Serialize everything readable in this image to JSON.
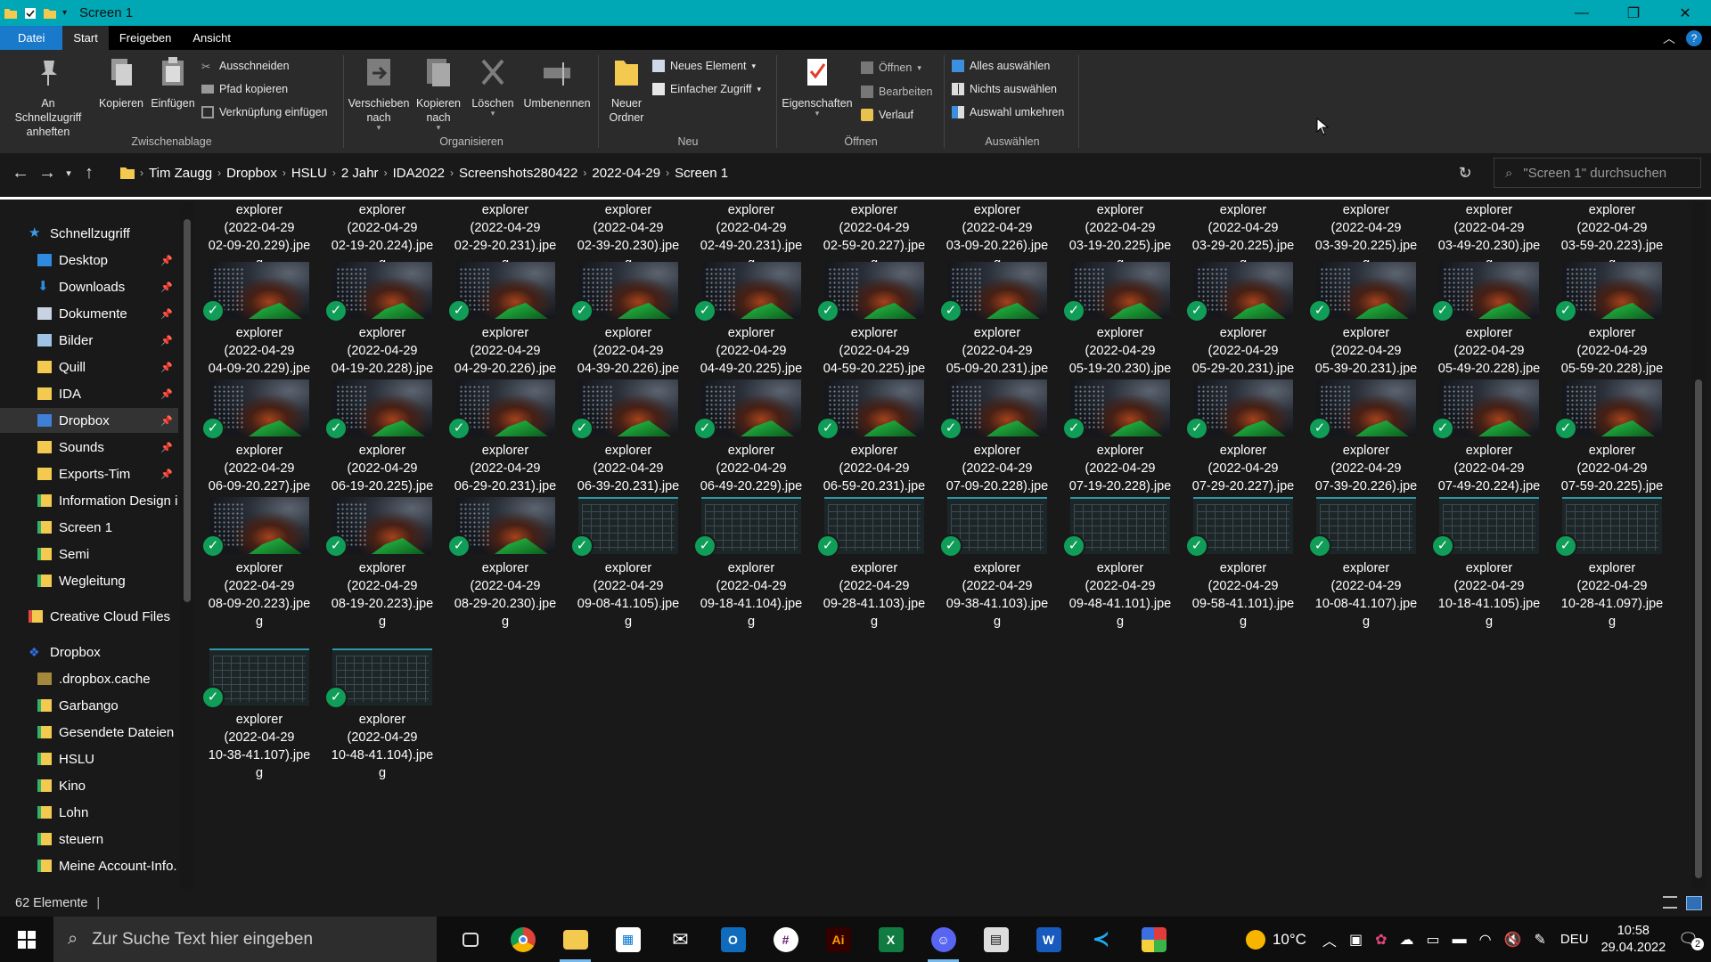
{
  "window": {
    "title": "Screen 1"
  },
  "ribbon_tabs": [
    "Datei",
    "Start",
    "Freigeben",
    "Ansicht"
  ],
  "ribbon": {
    "clipboard": {
      "pin": "An Schnellzugriff anheften",
      "copy": "Kopieren",
      "paste": "Einfügen",
      "cut": "Ausschneiden",
      "copy_path": "Pfad kopieren",
      "paste_link": "Verknüpfung einfügen",
      "label": "Zwischenablage"
    },
    "organize": {
      "move": "Verschieben nach",
      "copyto": "Kopieren nach",
      "delete": "Löschen",
      "rename": "Umbenennen",
      "label": "Organisieren"
    },
    "new": {
      "new_folder": "Neuer Ordner",
      "new_item": "Neues Element",
      "easy_access": "Einfacher Zugriff",
      "label": "Neu"
    },
    "open": {
      "properties": "Eigenschaften",
      "open": "Öffnen",
      "edit": "Bearbeiten",
      "history": "Verlauf",
      "label": "Öffnen"
    },
    "select": {
      "all": "Alles auswählen",
      "none": "Nichts auswählen",
      "invert": "Auswahl umkehren",
      "label": "Auswählen"
    }
  },
  "breadcrumb": [
    "Tim Zaugg",
    "Dropbox",
    "HSLU",
    "2 Jahr",
    "IDA2022",
    "Screenshots280422",
    "2022-04-29",
    "Screen 1"
  ],
  "search": {
    "placeholder": "\"Screen 1\" durchsuchen"
  },
  "nav": {
    "quick_access": "Schnellzugriff",
    "items": [
      {
        "label": "Desktop",
        "pinned": true
      },
      {
        "label": "Downloads",
        "pinned": true
      },
      {
        "label": "Dokumente",
        "pinned": true
      },
      {
        "label": "Bilder",
        "pinned": true
      },
      {
        "label": "Quill",
        "pinned": true
      },
      {
        "label": "IDA",
        "pinned": true
      },
      {
        "label": "Dropbox",
        "pinned": true
      },
      {
        "label": "Sounds",
        "pinned": true
      },
      {
        "label": "Exports-Tim",
        "pinned": true
      },
      {
        "label": "Information Design i",
        "pinned": false
      },
      {
        "label": "Screen 1",
        "pinned": false
      },
      {
        "label": "Semi",
        "pinned": false
      },
      {
        "label": "Wegleitung",
        "pinned": false
      }
    ],
    "creative_cloud": "Creative Cloud Files",
    "dropbox": "Dropbox",
    "dropbox_items": [
      ".dropbox.cache",
      "Garbango",
      "Gesendete Dateien",
      "HSLU",
      "Kino",
      "Lohn",
      "steuern",
      "Meine Account-Info."
    ]
  },
  "files": {
    "top_partial": [
      [
        "explorer",
        "(2022-04-29",
        "02-09-20.229).jpe",
        "g"
      ],
      [
        "explorer",
        "(2022-04-29",
        "02-19-20.224).jpe",
        "g"
      ],
      [
        "explorer",
        "(2022-04-29",
        "02-29-20.231).jpe",
        "g"
      ],
      [
        "explorer",
        "(2022-04-29",
        "02-39-20.230).jpe",
        "g"
      ],
      [
        "explorer",
        "(2022-04-29",
        "02-49-20.231).jpe",
        "g"
      ],
      [
        "explorer",
        "(2022-04-29",
        "02-59-20.227).jpe",
        "g"
      ],
      [
        "explorer",
        "(2022-04-29",
        "03-09-20.226).jpe",
        "g"
      ],
      [
        "explorer",
        "(2022-04-29",
        "03-19-20.225).jpe",
        "g"
      ],
      [
        "explorer",
        "(2022-04-29",
        "03-29-20.225).jpe",
        "g"
      ],
      [
        "explorer",
        "(2022-04-29",
        "03-39-20.225).jpe",
        "g"
      ],
      [
        "explorer",
        "(2022-04-29",
        "03-49-20.230).jpe",
        "g"
      ],
      [
        "explorer",
        "(2022-04-29",
        "03-59-20.223).jpe",
        "g"
      ]
    ],
    "row1": [
      [
        "explorer",
        "(2022-04-29",
        "04-09-20.229).jpe",
        "g"
      ],
      [
        "explorer",
        "(2022-04-29",
        "04-19-20.228).jpe",
        "g"
      ],
      [
        "explorer",
        "(2022-04-29",
        "04-29-20.226).jpe",
        "g"
      ],
      [
        "explorer",
        "(2022-04-29",
        "04-39-20.226).jpe",
        "g"
      ],
      [
        "explorer",
        "(2022-04-29",
        "04-49-20.225).jpe",
        "g"
      ],
      [
        "explorer",
        "(2022-04-29",
        "04-59-20.225).jpe",
        "g"
      ],
      [
        "explorer",
        "(2022-04-29",
        "05-09-20.231).jpe",
        "g"
      ],
      [
        "explorer",
        "(2022-04-29",
        "05-19-20.230).jpe",
        "g"
      ],
      [
        "explorer",
        "(2022-04-29",
        "05-29-20.231).jpe",
        "g"
      ],
      [
        "explorer",
        "(2022-04-29",
        "05-39-20.231).jpe",
        "g"
      ],
      [
        "explorer",
        "(2022-04-29",
        "05-49-20.228).jpe",
        "g"
      ],
      [
        "explorer",
        "(2022-04-29",
        "05-59-20.228).jpe",
        "g"
      ]
    ],
    "row2": [
      [
        "explorer",
        "(2022-04-29",
        "06-09-20.227).jpe",
        "g"
      ],
      [
        "explorer",
        "(2022-04-29",
        "06-19-20.225).jpe",
        "g"
      ],
      [
        "explorer",
        "(2022-04-29",
        "06-29-20.231).jpe",
        "g"
      ],
      [
        "explorer",
        "(2022-04-29",
        "06-39-20.231).jpe",
        "g"
      ],
      [
        "explorer",
        "(2022-04-29",
        "06-49-20.229).jpe",
        "g"
      ],
      [
        "explorer",
        "(2022-04-29",
        "06-59-20.231).jpe",
        "g"
      ],
      [
        "explorer",
        "(2022-04-29",
        "07-09-20.228).jpe",
        "g"
      ],
      [
        "explorer",
        "(2022-04-29",
        "07-19-20.228).jpe",
        "g"
      ],
      [
        "explorer",
        "(2022-04-29",
        "07-29-20.227).jpe",
        "g"
      ],
      [
        "explorer",
        "(2022-04-29",
        "07-39-20.226).jpe",
        "g"
      ],
      [
        "explorer",
        "(2022-04-29",
        "07-49-20.224).jpe",
        "g"
      ],
      [
        "explorer",
        "(2022-04-29",
        "07-59-20.225).jpe",
        "g"
      ]
    ],
    "row3": [
      [
        "explorer",
        "(2022-04-29",
        "08-09-20.223).jpe",
        "g"
      ],
      [
        "explorer",
        "(2022-04-29",
        "08-19-20.223).jpe",
        "g"
      ],
      [
        "explorer",
        "(2022-04-29",
        "08-29-20.230).jpe",
        "g"
      ],
      [
        "explorer",
        "(2022-04-29",
        "09-08-41.105).jpe",
        "g"
      ],
      [
        "explorer",
        "(2022-04-29",
        "09-18-41.104).jpe",
        "g"
      ],
      [
        "explorer",
        "(2022-04-29",
        "09-28-41.103).jpe",
        "g"
      ],
      [
        "explorer",
        "(2022-04-29",
        "09-38-41.103).jpe",
        "g"
      ],
      [
        "explorer",
        "(2022-04-29",
        "09-48-41.101).jpe",
        "g"
      ],
      [
        "explorer",
        "(2022-04-29",
        "09-58-41.101).jpe",
        "g"
      ],
      [
        "explorer",
        "(2022-04-29",
        "10-08-41.107).jpe",
        "g"
      ],
      [
        "explorer",
        "(2022-04-29",
        "10-18-41.105).jpe",
        "g"
      ],
      [
        "explorer",
        "(2022-04-29",
        "10-28-41.097).jpe",
        "g"
      ]
    ],
    "row4": [
      [
        "explorer",
        "(2022-04-29",
        "10-38-41.107).jpe",
        "g"
      ],
      [
        "explorer",
        "(2022-04-29",
        "10-48-41.104).jpe",
        "g"
      ]
    ]
  },
  "status": {
    "count": "62 Elemente"
  },
  "taskbar": {
    "search_placeholder": "Zur Suche Text hier eingeben",
    "weather": "10°C",
    "lang": "DEU",
    "time": "10:58",
    "date": "29.04.2022",
    "notifications": "2"
  }
}
